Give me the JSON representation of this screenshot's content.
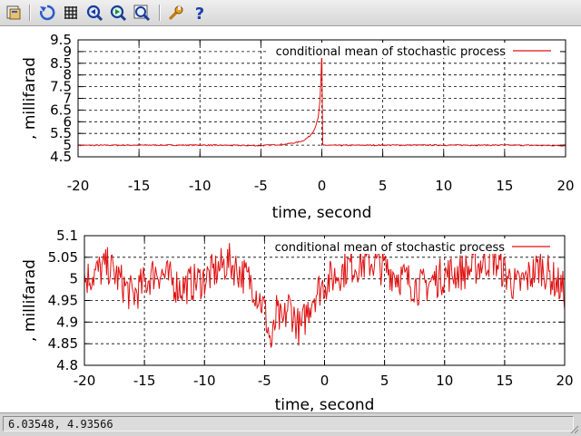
{
  "toolbar": {
    "buttons": [
      {
        "id": "copy",
        "icon": "copy-to-clipboard-icon"
      },
      {
        "id": "replot",
        "icon": "replot-icon"
      },
      {
        "id": "grid",
        "icon": "grid-icon"
      },
      {
        "id": "zoom_prev",
        "icon": "zoom-previous-icon"
      },
      {
        "id": "zoom_next",
        "icon": "zoom-next-icon"
      },
      {
        "id": "unzoom",
        "icon": "unzoom-icon"
      },
      {
        "id": "options",
        "icon": "options-wrench-icon"
      },
      {
        "id": "help",
        "icon": "help-icon"
      }
    ]
  },
  "status": {
    "coords": "6.03548,  4.93566"
  },
  "chart_data": [
    {
      "type": "line",
      "xlabel": "time, second",
      "ylabel": ", millifarad",
      "xlim": [
        -20,
        20
      ],
      "ylim": [
        4.5,
        9.5
      ],
      "xticks": [
        -20,
        -15,
        -10,
        -5,
        0,
        5,
        10,
        15,
        20
      ],
      "yticks": [
        4.5,
        5,
        5.5,
        6,
        6.5,
        7,
        7.5,
        8,
        8.5,
        9,
        9.5
      ],
      "ytick_labels": [
        "4.5",
        "5",
        "5.5",
        "6",
        "6.5",
        "7",
        "7.5",
        "8",
        "8.5",
        "9",
        "9.5"
      ],
      "grid": true,
      "legend_position": "top-right",
      "color": "#e01010",
      "series": [
        {
          "name": "conditional mean of stochastic process",
          "x": [
            -20,
            -15,
            -10,
            -5,
            -3,
            -2,
            -1.5,
            -1,
            -0.6,
            -0.3,
            -0.15,
            -0.05,
            0,
            0.02,
            0.1,
            1,
            5,
            10,
            15,
            20
          ],
          "y": [
            4.99,
            5.0,
            5.0,
            4.98,
            5.04,
            5.12,
            5.2,
            5.38,
            5.68,
            6.15,
            6.9,
            8.1,
            9.0,
            5.05,
            5.0,
            4.99,
            5.0,
            5.0,
            5.0,
            4.98
          ]
        }
      ]
    },
    {
      "type": "line",
      "xlabel": "time, second",
      "ylabel": ", millifarad",
      "xlim": [
        -20,
        20
      ],
      "ylim": [
        4.8,
        5.1
      ],
      "xticks": [
        -20,
        -15,
        -10,
        -5,
        0,
        5,
        10,
        15,
        20
      ],
      "yticks": [
        4.8,
        4.85,
        4.9,
        4.95,
        5,
        5.05,
        5.1
      ],
      "ytick_labels": [
        "4.8",
        "4.85",
        "4.9",
        "4.95",
        "5",
        "5.05",
        "5.1"
      ],
      "grid": true,
      "legend_position": "top-right",
      "color": "#e01010",
      "series": [
        {
          "name": "conditional mean of stochastic process",
          "x": [
            -20,
            -18,
            -16,
            -14,
            -12,
            -10,
            -8,
            -6,
            -5,
            -4.4,
            -4,
            -3.5,
            -3,
            -2,
            -1,
            0,
            2,
            4,
            6,
            8,
            10,
            12,
            14,
            16,
            18,
            20
          ],
          "y": [
            5.0,
            5.03,
            4.96,
            5.02,
            4.98,
            5.0,
            5.04,
            4.99,
            4.93,
            4.84,
            4.92,
            4.89,
            4.94,
            4.88,
            4.96,
            4.99,
            5.03,
            5.04,
            5.01,
            4.98,
            5.01,
            5.02,
            5.05,
            4.98,
            5.03,
            4.97
          ]
        }
      ]
    }
  ]
}
